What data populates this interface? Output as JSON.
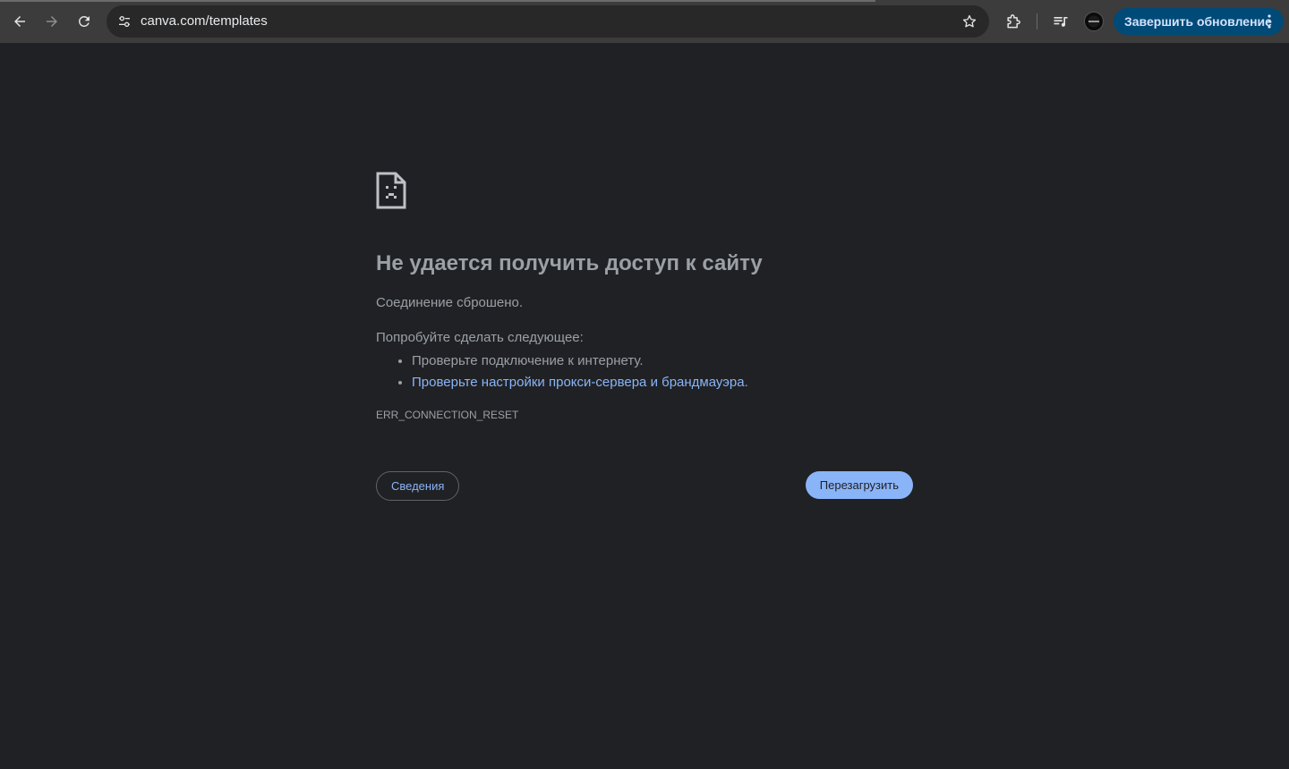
{
  "browser": {
    "omnibox": {
      "url": "canva.com/templates"
    },
    "update_button": {
      "label": "Завершить обновление"
    },
    "icons": {
      "back": "arrow-left-icon",
      "forward": "arrow-right-icon",
      "reload": "reload-icon",
      "site_info": "tune-icon",
      "bookmark": "star-icon",
      "extensions": "puzzle-icon",
      "media": "playlist-music-icon",
      "profile": "avatar",
      "menu": "kebab-menu-icon"
    }
  },
  "error_page": {
    "title": "Не удается получить доступ к сайту",
    "description": "Соединение сброшено.",
    "suggestions_intro": "Попробуйте сделать следующее:",
    "suggestions": [
      {
        "text": "Проверьте подключение к интернету.",
        "link": false
      },
      {
        "text": "Проверьте настройки прокси-сервера и брандмауэра",
        "link": true,
        "suffix": "."
      }
    ],
    "error_code": "ERR_CONNECTION_RESET",
    "details_button": "Сведения",
    "reload_button": "Перезагрузить"
  },
  "colors": {
    "background": "#202124",
    "toolbar": "#3c3c3c",
    "text": "#9aa0a6",
    "link": "#8ab4f8",
    "update_button_bg": "#004a77"
  }
}
